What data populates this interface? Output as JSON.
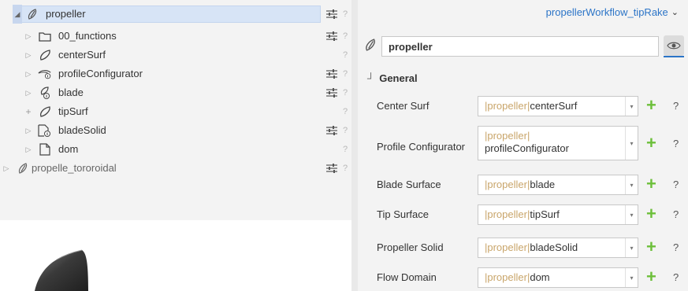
{
  "tree": {
    "items": [
      {
        "label": "propeller",
        "expander": "◢",
        "selected": true
      },
      {
        "label": "00_functions",
        "expander": "▷"
      },
      {
        "label": "centerSurf",
        "expander": "▷"
      },
      {
        "label": "profileConfigurator",
        "expander": "▷"
      },
      {
        "label": "blade",
        "expander": "▷"
      },
      {
        "label": "tipSurf",
        "expander": "+"
      },
      {
        "label": "bladeSolid",
        "expander": "▷"
      },
      {
        "label": "dom",
        "expander": "▷"
      },
      {
        "label": "propelle_tororoidal",
        "expander": "▷"
      }
    ],
    "help_mark": "?"
  },
  "properties": {
    "workflow_selector": "propellerWorkflow_tipRake",
    "workflow_chevron": "⌄",
    "name_value": "propeller",
    "section_corner": "┘",
    "section_title": "General",
    "fields": [
      {
        "label": "Center Surf",
        "scope": "|propeller|",
        "value": "centerSurf"
      },
      {
        "label": "Profile Configurator",
        "scope": "|propeller|",
        "value": "profileConfigurator"
      },
      {
        "label": "Blade Surface",
        "scope": "|propeller|",
        "value": "blade"
      },
      {
        "label": "Tip Surface",
        "scope": "|propeller|",
        "value": "tipSurf"
      },
      {
        "label": "Propeller Solid",
        "scope": "|propeller|",
        "value": "bladeSolid"
      },
      {
        "label": "Flow Domain",
        "scope": "|propeller|",
        "value": "dom"
      }
    ],
    "add_symbol": "+",
    "help_mark": "?",
    "dropdown_symbol": "▾"
  },
  "colors": {
    "accent": "#2b74c7",
    "add_green": "#6cbf3a",
    "scope_text": "#c9a56a",
    "selection": "#d7e4f6"
  }
}
